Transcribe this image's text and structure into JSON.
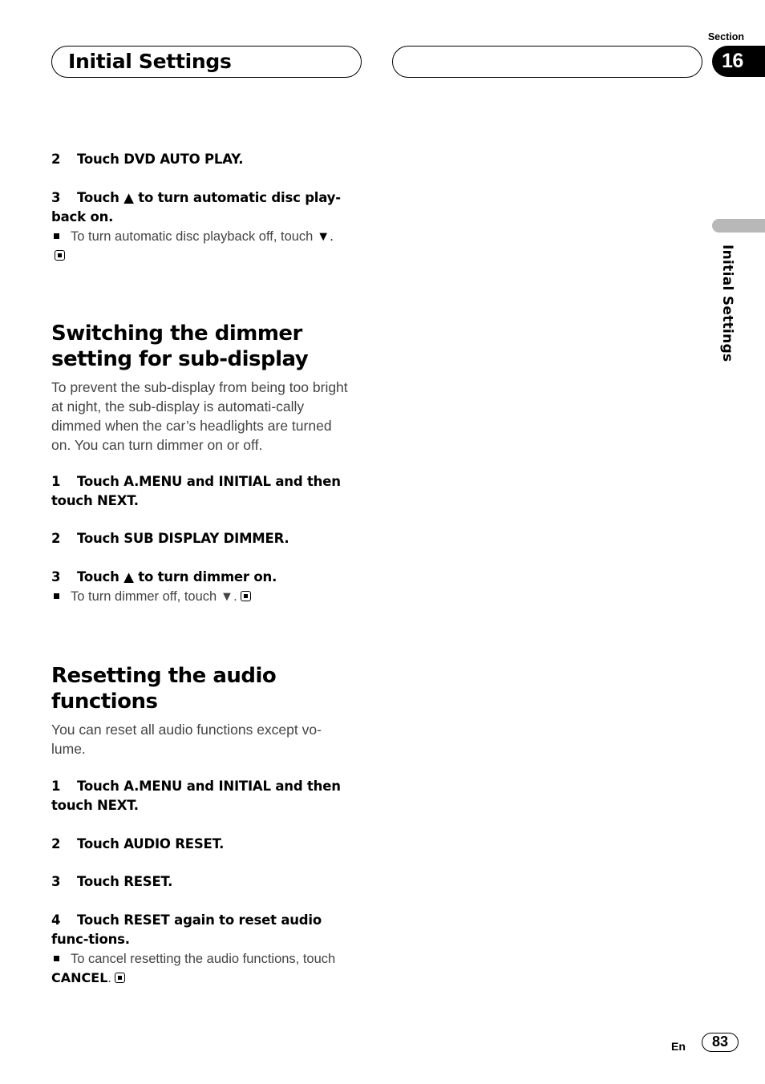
{
  "header": {
    "title": "Initial Settings",
    "section_label": "Section",
    "section_number": "16",
    "side_label": "Initial Settings"
  },
  "dvd_auto_play": {
    "steps": [
      {
        "num": "2",
        "text": "Touch DVD AUTO PLAY."
      },
      {
        "num": "3",
        "text": "Touch ▲ to turn automatic disc play-back on."
      }
    ],
    "note": "To turn automatic disc playback off, touch",
    "note_symbol": "▼."
  },
  "dimmer_section": {
    "title": "Switching the dimmer setting for sub-display",
    "description": "To prevent the sub-display from being too bright at night, the sub-display is automati-cally dimmed when the car’s headlights are turned on. You can turn dimmer on or off.",
    "steps": [
      {
        "num": "1",
        "text": "Touch A.MENU and INITIAL and then touch NEXT."
      },
      {
        "num": "2",
        "text": "Touch SUB DISPLAY DIMMER."
      },
      {
        "num": "3",
        "text": "Touch ▲ to turn dimmer on."
      }
    ],
    "note": "To turn dimmer off, touch ▼."
  },
  "audio_reset_section": {
    "title": "Resetting the audio functions",
    "description": "You can reset all audio functions except vo-lume.",
    "steps": [
      {
        "num": "1",
        "text": "Touch A.MENU and INITIAL and then touch NEXT."
      },
      {
        "num": "2",
        "text": "Touch AUDIO RESET."
      },
      {
        "num": "3",
        "text": "Touch RESET."
      },
      {
        "num": "4",
        "text": "Touch RESET again to reset audio func-tions."
      }
    ],
    "note": "To cancel resetting the audio functions, touch",
    "note_bold": "CANCEL",
    "note_end": "."
  },
  "footer": {
    "language": "En",
    "page_number": "83"
  }
}
